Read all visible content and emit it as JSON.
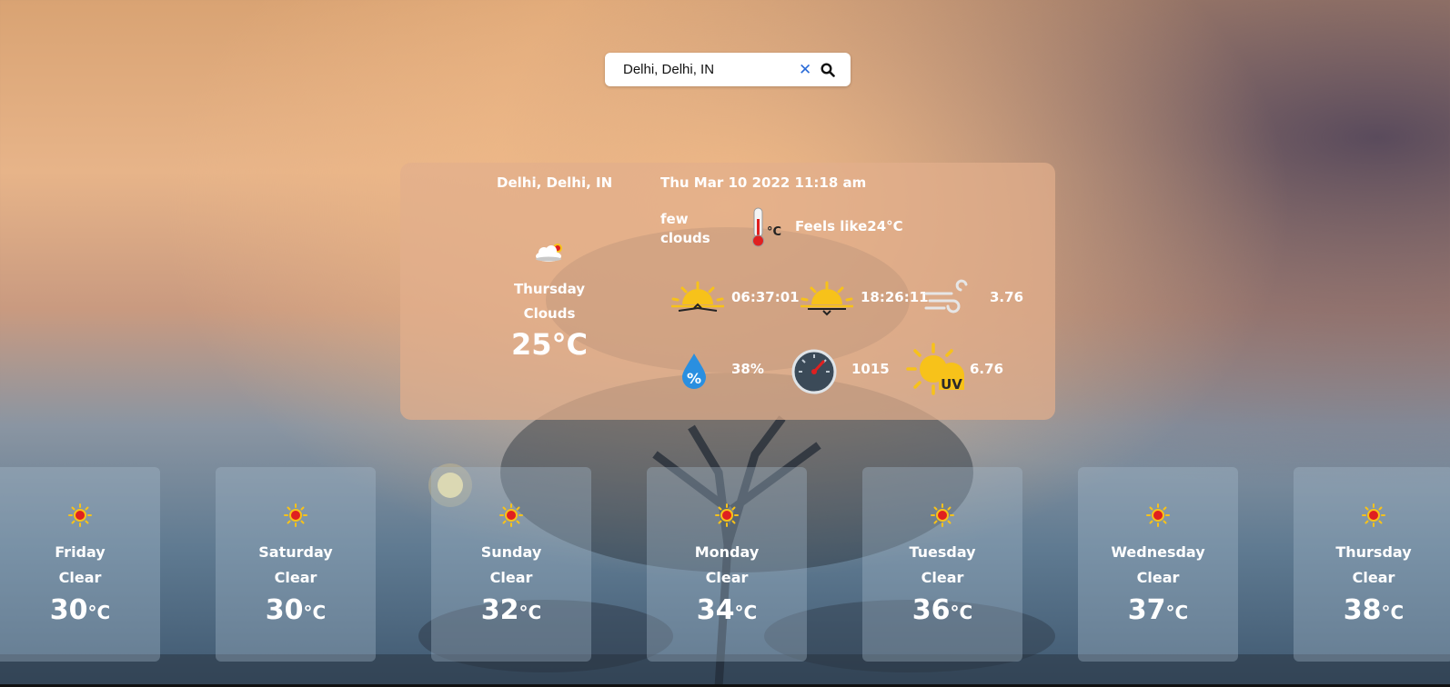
{
  "search": {
    "value": "Delhi, Delhi, IN",
    "clear_icon": "close-icon",
    "search_icon": "search-icon"
  },
  "current": {
    "location": "Delhi, Delhi, IN",
    "datetime": "Thu Mar 10 2022 11:18 am",
    "description": "few clouds",
    "feels_like": "Feels like24°C",
    "day": "Thursday",
    "condition": "Clouds",
    "temperature": "25°C",
    "sunrise": "06:37:01",
    "sunset": "18:26:11",
    "wind": "3.76",
    "humidity": "38%",
    "pressure": "1015",
    "uv": "6.76",
    "uv_label": "UV",
    "thermo_unit": "°C"
  },
  "forecast": [
    {
      "day": "Friday",
      "condition": "Clear",
      "temp": "30",
      "unit": "°C"
    },
    {
      "day": "Saturday",
      "condition": "Clear",
      "temp": "30",
      "unit": "°C"
    },
    {
      "day": "Sunday",
      "condition": "Clear",
      "temp": "32",
      "unit": "°C"
    },
    {
      "day": "Monday",
      "condition": "Clear",
      "temp": "34",
      "unit": "°C"
    },
    {
      "day": "Tuesday",
      "condition": "Clear",
      "temp": "36",
      "unit": "°C"
    },
    {
      "day": "Wednesday",
      "condition": "Clear",
      "temp": "37",
      "unit": "°C"
    },
    {
      "day": "Thursday",
      "condition": "Clear",
      "temp": "38",
      "unit": "°C"
    }
  ],
  "colors": {
    "card_bg": "#e2af8c",
    "forecast_bg": "#aabecd",
    "sun_yellow": "#f7c21a",
    "sun_red": "#e02020",
    "drop_blue": "#2a8fe0"
  }
}
